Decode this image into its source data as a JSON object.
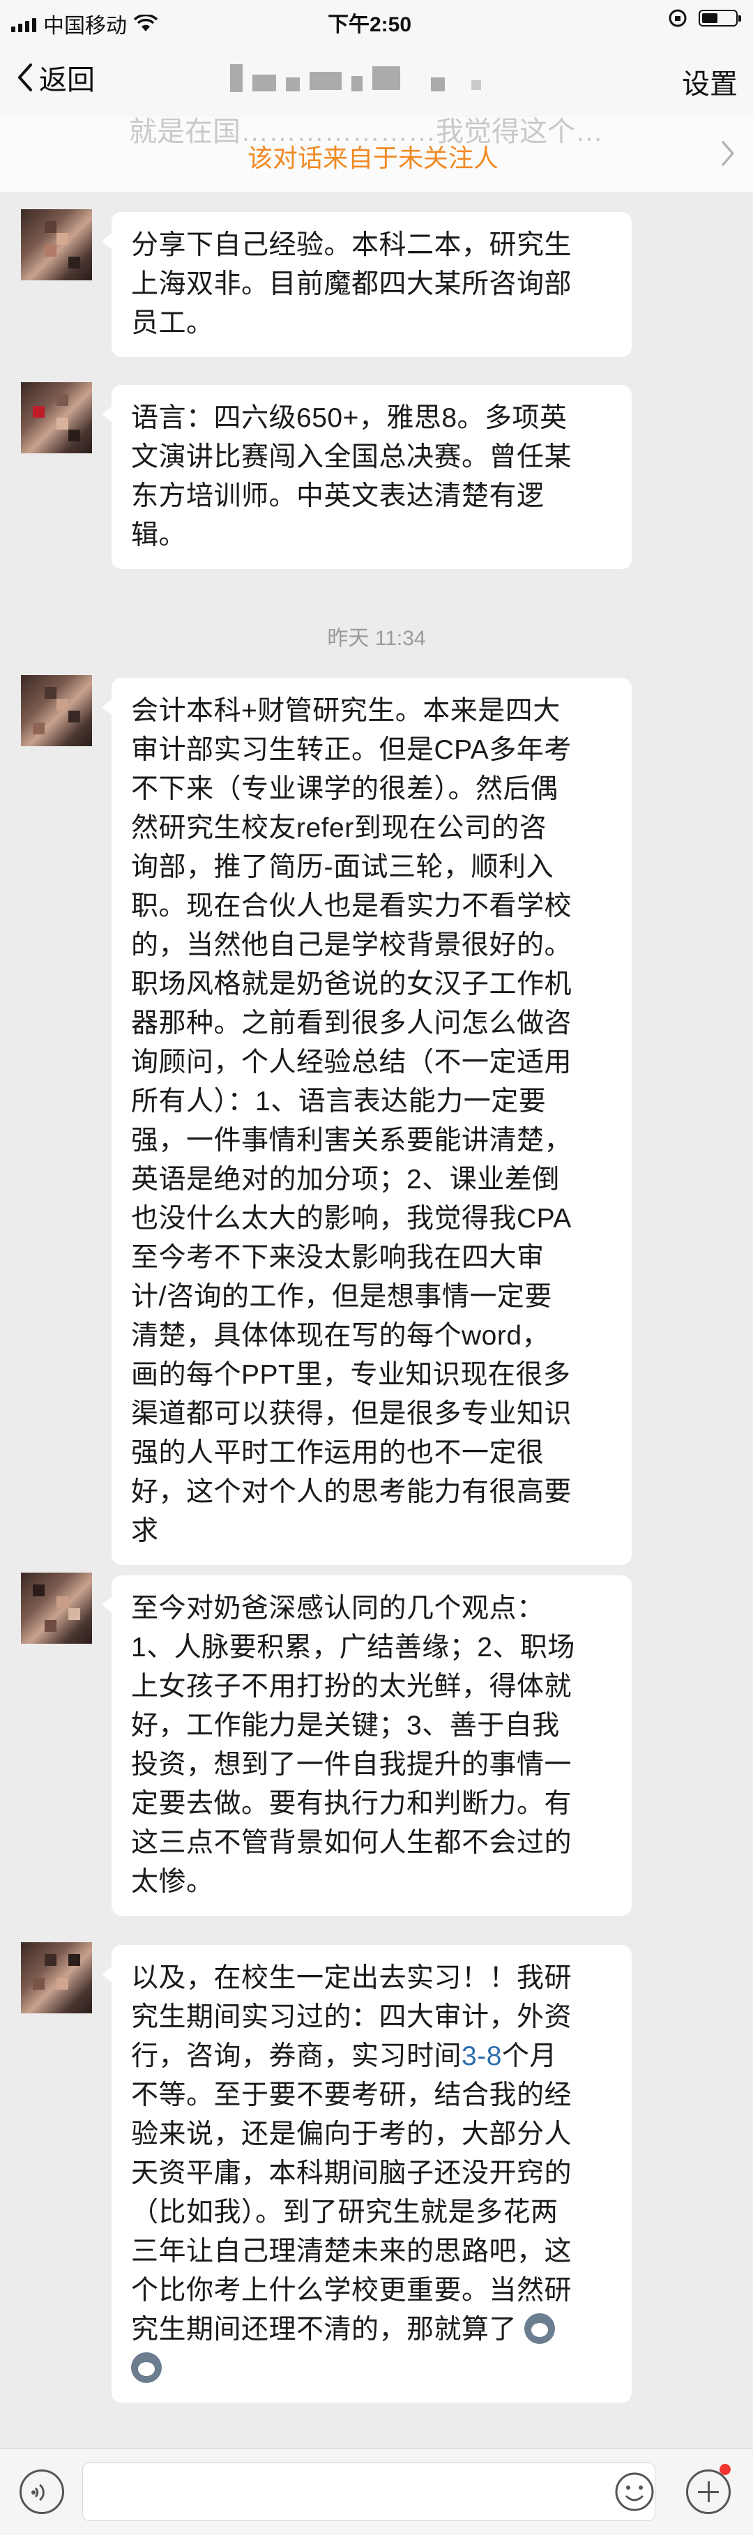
{
  "status_bar": {
    "carrier": "中国移动",
    "time": "下午2:50"
  },
  "nav": {
    "back_label": "返回",
    "settings_label": "设置"
  },
  "notice": {
    "ghost_text": "就是在国…………………我觉得这个…",
    "text": "该对话来自于未关注人"
  },
  "messages": [
    {
      "lines": [
        "分享下自己经验。本科二本，研究生",
        "上海双非。目前魔都四大某所咨询部",
        "员工。"
      ]
    },
    {
      "lines": [
        "语言：四六级650+，雅思8。多项英",
        "文演讲比赛闯入全国总决赛。曾任某",
        "东方培训师。中英文表达清楚有逻",
        "辑。"
      ]
    },
    {
      "lines": [
        "会计本科+财管研究生。本来是四大",
        "审计部实习生转正。但是CPA多年考",
        "不下来（专业课学的很差）。然后偶",
        "然研究生校友refer到现在公司的咨",
        "询部，推了简历-面试三轮，顺利入",
        "职。现在合伙人也是看实力不看学校",
        "的，当然他自己是学校背景很好的。",
        "职场风格就是奶爸说的女汉子工作机",
        "器那种。之前看到很多人问怎么做咨",
        "询顾问，个人经验总结（不一定适用",
        "所有人）：1、语言表达能力一定要",
        "强，一件事情利害关系要能讲清楚，",
        "英语是绝对的加分项；2、课业差倒",
        "也没什么太大的影响，我觉得我CPA",
        "至今考不下来没太影响我在四大审",
        "计/咨询的工作，但是想事情一定要",
        "清楚，具体体现在写的每个word，",
        "画的每个PPT里，专业知识现在很多",
        "渠道都可以获得，但是很多专业知识",
        "强的人平时工作运用的也不一定很",
        "好，这个对个人的思考能力有很高要",
        "求"
      ]
    },
    {
      "lines": [
        "至今对奶爸深感认同的几个观点：",
        "1、人脉要积累，广结善缘；2、职场",
        "上女孩子不用打扮的太光鲜，得体就",
        "好，工作能力是关键；3、善于自我",
        "投资，想到了一件自我提升的事情一",
        "定要去做。要有执行力和判断力。有",
        "这三点不管背景如何人生都不会过的",
        "太惨。"
      ]
    },
    {
      "line1": "以及，在校生一定出去实习！！我研",
      "line2": "究生期间实习过的：四大审计，外资",
      "line3_pre": "行，咨询，券商，实习时间",
      "line3_link": "3-8",
      "line3_post": "个月",
      "rest": [
        "不等。至于要不要考研，结合我的经",
        "验来说，还是偏向于考的，大部分人",
        "天资平庸，本科期间脑子还没开窍的",
        "（比如我）。到了研究生就是多花两",
        "三年让自己理清楚未来的思路吧，这",
        "个比你考上什么学校更重要。当然研",
        "究生期间还理不清的，那就算了"
      ]
    }
  ],
  "timestamp": "昨天 11:34"
}
